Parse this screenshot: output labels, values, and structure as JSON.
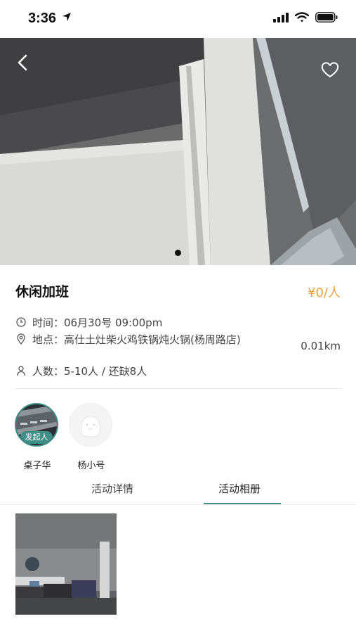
{
  "status_bar": {
    "time": "3:36"
  },
  "event": {
    "title": "休闲加班",
    "price": "¥0/人",
    "time_label": "时间：",
    "time_value": "06月30号 09:00pm",
    "place_label": "地点：",
    "place_value": "高仕土灶柴火鸡铁锅炖火锅(杨周路店)",
    "count_label": "人数：",
    "count_value": "5-10人 / 还缺8人",
    "distance": "0.01km"
  },
  "carousel": {
    "current_slide": 1,
    "total_slides": 1
  },
  "members": [
    {
      "name": "桌子华",
      "badge": "发起人"
    },
    {
      "name": "杨小号"
    }
  ],
  "tabs": [
    {
      "label": "活动详情",
      "active": false
    },
    {
      "label": "活动相册",
      "active": true
    }
  ],
  "colors": {
    "accent": "#3f8f88",
    "price": "#e8a33b"
  },
  "icons": [
    "back-icon",
    "heart-icon",
    "clock-icon",
    "location-pin-icon",
    "person-icon",
    "signal-icon",
    "wifi-icon",
    "battery-icon",
    "location-arrow-icon"
  ]
}
